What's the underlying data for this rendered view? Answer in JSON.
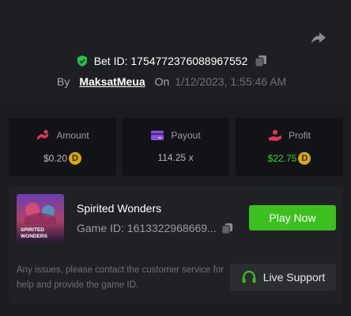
{
  "bet": {
    "id_label": "Bet ID: 1754772376088967552",
    "by_label": "By",
    "username": "MaksatMeua",
    "on_label": "On",
    "timestamp": "1/12/2023, 1:55:46 AM"
  },
  "stats": {
    "amount_label": "Amount",
    "amount_value": "$0.20",
    "payout_label": "Payout",
    "payout_value": "114.25 x",
    "profit_label": "Profit",
    "profit_value": "$22.75",
    "coin_symbol": "D"
  },
  "game": {
    "name": "Spirited Wonders",
    "id_label": "Game ID: 1613322968669...",
    "play_label": "Play Now",
    "thumb_line1": "SPIRITED",
    "thumb_line2": "WONDERS"
  },
  "support": {
    "notice": "Any issues, please contact the customer service for help and provide the game ID.",
    "button_label": "Live Support"
  },
  "colors": {
    "accent_green": "#3dbf1f",
    "profit_green": "#3dd03a",
    "coin_gold": "#d8a61a",
    "amount_icon": "#e0365a",
    "payout_icon": "#8b4fe0",
    "profit_icon": "#e0365a"
  },
  "icons": [
    "share-icon",
    "shield-check-icon",
    "copy-icon",
    "amount-icon",
    "payout-icon",
    "profit-icon",
    "coin-icon",
    "headset-icon"
  ]
}
